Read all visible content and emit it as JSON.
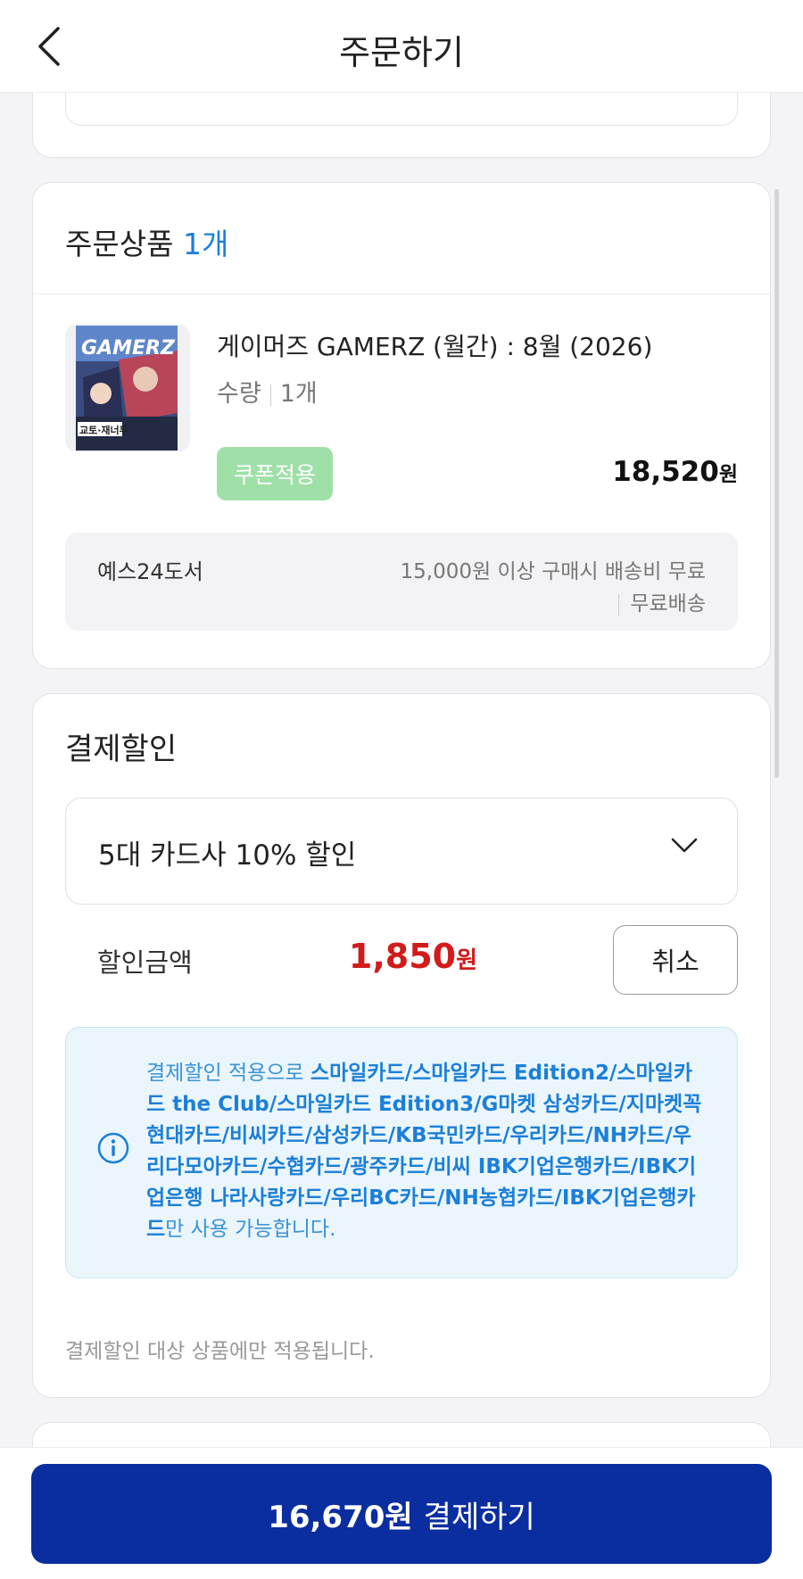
{
  "header": {
    "title": "주문하기",
    "back_icon": "chevron-left-icon"
  },
  "order_items": {
    "title": "주문상품",
    "count": "1개",
    "product": {
      "title": "게이머즈 GAMERZ (월간) : 8월 (2026)",
      "qty_label": "수량",
      "qty_value": "1개",
      "coupon_label": "쿠폰적용",
      "price": "18,520",
      "price_unit": "원",
      "cover_text": "GAMERZ",
      "cover_caption": "교토·재너두"
    },
    "shipping": {
      "seller": "예스24도서",
      "condition": "15,000원 이상 구매시 배송비 무료",
      "fee": "무료배송"
    }
  },
  "payment_discount": {
    "title": "결제할인",
    "selected_option": "5대 카드사 10% 할인",
    "amount_label": "할인금액",
    "amount": "1,850",
    "amount_unit": "원",
    "cancel_label": "취소",
    "info": {
      "prefix": "결제할인 적용으로 ",
      "cards": "스마일카드/스마일카드 Edition2/스마일카드 the Club/스마일카드 Edition3/G마켓 삼성카드/지마켓꼭 현대카드/비씨카드/삼성카드/KB국민카드/우리카드/NH카드/우리다모아카드/수협카드/광주카드/비씨 IBK기업은행카드/IBK기업은행 나라사랑카드/우리BC카드/NH농협카드/IBK기업은행카드",
      "suffix": "만 사용 가능합니다."
    },
    "note": "결제할인 대상 상품에만 적용됩니다."
  },
  "pay_button": {
    "amount": "16,670원",
    "label": "결제하기"
  },
  "colors": {
    "primary": "#0a2e9f",
    "accent_blue": "#1c7fd8",
    "discount_red": "#d21b1b",
    "coupon_green": "#9fe0a8"
  }
}
